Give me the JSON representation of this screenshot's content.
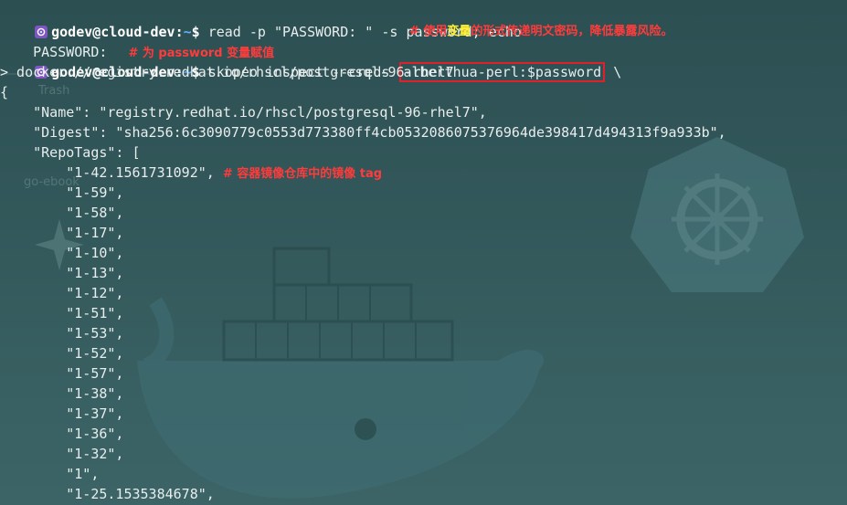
{
  "colors": {
    "background": "#335a5d",
    "text": "#e8eded",
    "comment": "#ff3b3b",
    "highlight": "#ffee33",
    "box": "#e0202a",
    "host_tilde": "#5fb0ff"
  },
  "icons": {
    "prompt": "kubernetes-wheel-icon"
  },
  "desktop": {
    "ghost_labels": [
      "Trash",
      "go-ebook"
    ]
  },
  "terminal": {
    "line1": {
      "user": "godev@cloud-dev",
      "sep": ":",
      "path": "~",
      "dollar": "$",
      "command": " read -p \"PASSWORD: \" -s password; echo"
    },
    "line2": {
      "text": "PASSWORD: ",
      "comment": "# 为 password 变量赋值",
      "comment2_prefix": "# 使用",
      "comment2_highlight": "变量",
      "comment2_suffix": "的形式传递明文密码，降低暴露风险。"
    },
    "line3": {
      "user": "godev@cloud-dev",
      "sep": ":",
      "path": "~",
      "dollar": "$",
      "command": " skopeo inspect --creds ",
      "creds": "alberthua-perl:$password",
      "tail": " \\"
    },
    "line4": "> docker://registry.redhat.io/rhscl/postgresql-96-rhel7",
    "output": [
      "{",
      "    \"Name\": \"registry.redhat.io/rhscl/postgresql-96-rhel7\",",
      "    \"Digest\": \"sha256:6c3090779c0553d773380ff4cb0532086075376964de398417d494313f9a933b\",",
      "    \"RepoTags\": [",
      "        \"1-42.1561731092\", ",
      "        \"1-59\",",
      "        \"1-58\",",
      "        \"1-17\",",
      "        \"1-10\",",
      "        \"1-13\",",
      "        \"1-12\",",
      "        \"1-51\",",
      "        \"1-53\",",
      "        \"1-52\",",
      "        \"1-57\",",
      "        \"1-38\",",
      "        \"1-37\",",
      "        \"1-36\",",
      "        \"1-32\",",
      "        \"1\",",
      "        \"1-25.1535384678\","
    ],
    "tag_comment": "# 容器镜像仓库中的镜像 tag"
  }
}
